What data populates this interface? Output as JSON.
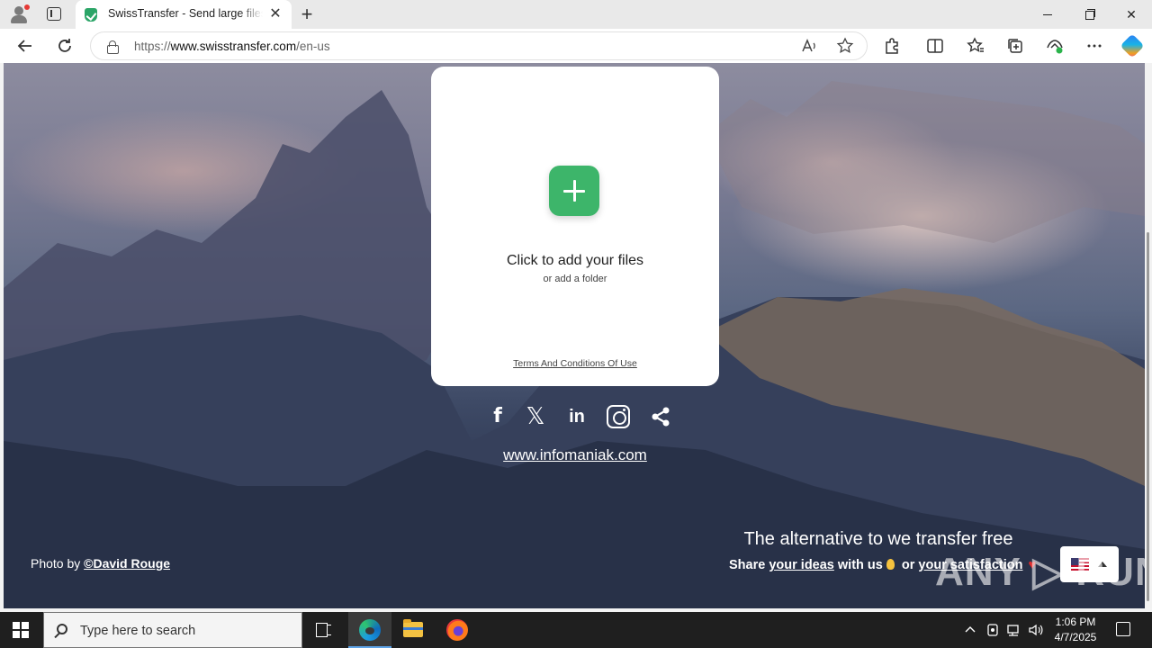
{
  "browser": {
    "tab_title": "SwissTransfer - Send large files se",
    "url_prefix": "https://",
    "url_domain": "www.swisstransfer.com",
    "url_path": "/en-us",
    "new_tab_symbol": "+",
    "close_symbol": "✕"
  },
  "upload": {
    "title": "Click to add your files",
    "subtitle": "or add a folder",
    "terms": "Terms And Conditions Of Use"
  },
  "socials": {
    "facebook": "f",
    "x": "𝕏",
    "linkedin": "in"
  },
  "site_link": "www.infomaniak.com",
  "footer": {
    "photo_by": "Photo by ",
    "photographer": "©David Rouge",
    "tagline": "The alternative to we transfer free",
    "share_prefix": "Share ",
    "share_ideas": "your ideas",
    "share_mid": " with us",
    "share_or": " or ",
    "share_satisfaction": "your satisfaction",
    "heart": "♥"
  },
  "watermark": "ANY ▷ RUN",
  "taskbar": {
    "search_placeholder": "Type here to search",
    "time": "1:06 PM",
    "date": "4/7/2025"
  },
  "colors": {
    "accent_green": "#3db56a",
    "taskbar": "#1f1f1f"
  }
}
